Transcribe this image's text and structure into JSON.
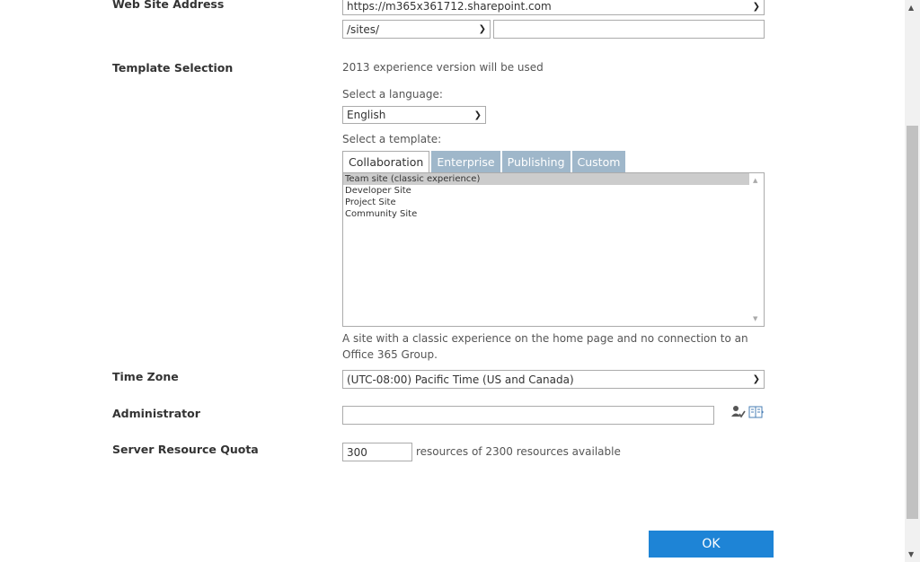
{
  "fields": {
    "web_site_address": {
      "label": "Web Site Address",
      "host_value": "https://m365x361712.sharepoint.com",
      "path_value": "/sites/",
      "name_value": ""
    },
    "template_selection": {
      "label": "Template Selection",
      "version_note": "2013 experience version will be used",
      "language_label": "Select a language:",
      "language_value": "English",
      "template_label": "Select a template:",
      "tabs": [
        {
          "label": "Collaboration",
          "active": true
        },
        {
          "label": "Enterprise",
          "active": false
        },
        {
          "label": "Publishing",
          "active": false
        },
        {
          "label": "Custom",
          "active": false
        }
      ],
      "templates": [
        "Team site (classic experience)",
        "Developer Site",
        "Project Site",
        "Community Site"
      ],
      "selected_template_index": 0,
      "description": "A site with a classic experience on the home page and no connection to an Office 365 Group."
    },
    "time_zone": {
      "label": "Time Zone",
      "value": "(UTC-08:00) Pacific Time (US and Canada)"
    },
    "administrator": {
      "label": "Administrator",
      "value": "",
      "icons": [
        "check-names-icon",
        "browse-address-book-icon"
      ]
    },
    "server_resource_quota": {
      "label": "Server Resource Quota",
      "value": "300",
      "note": "resources of 2300 resources available"
    }
  },
  "ok_button_label": "OK",
  "colors": {
    "accent": "#1e84d6",
    "tab_inactive": "#9fb7ca",
    "selected_row": "#cccccc"
  }
}
